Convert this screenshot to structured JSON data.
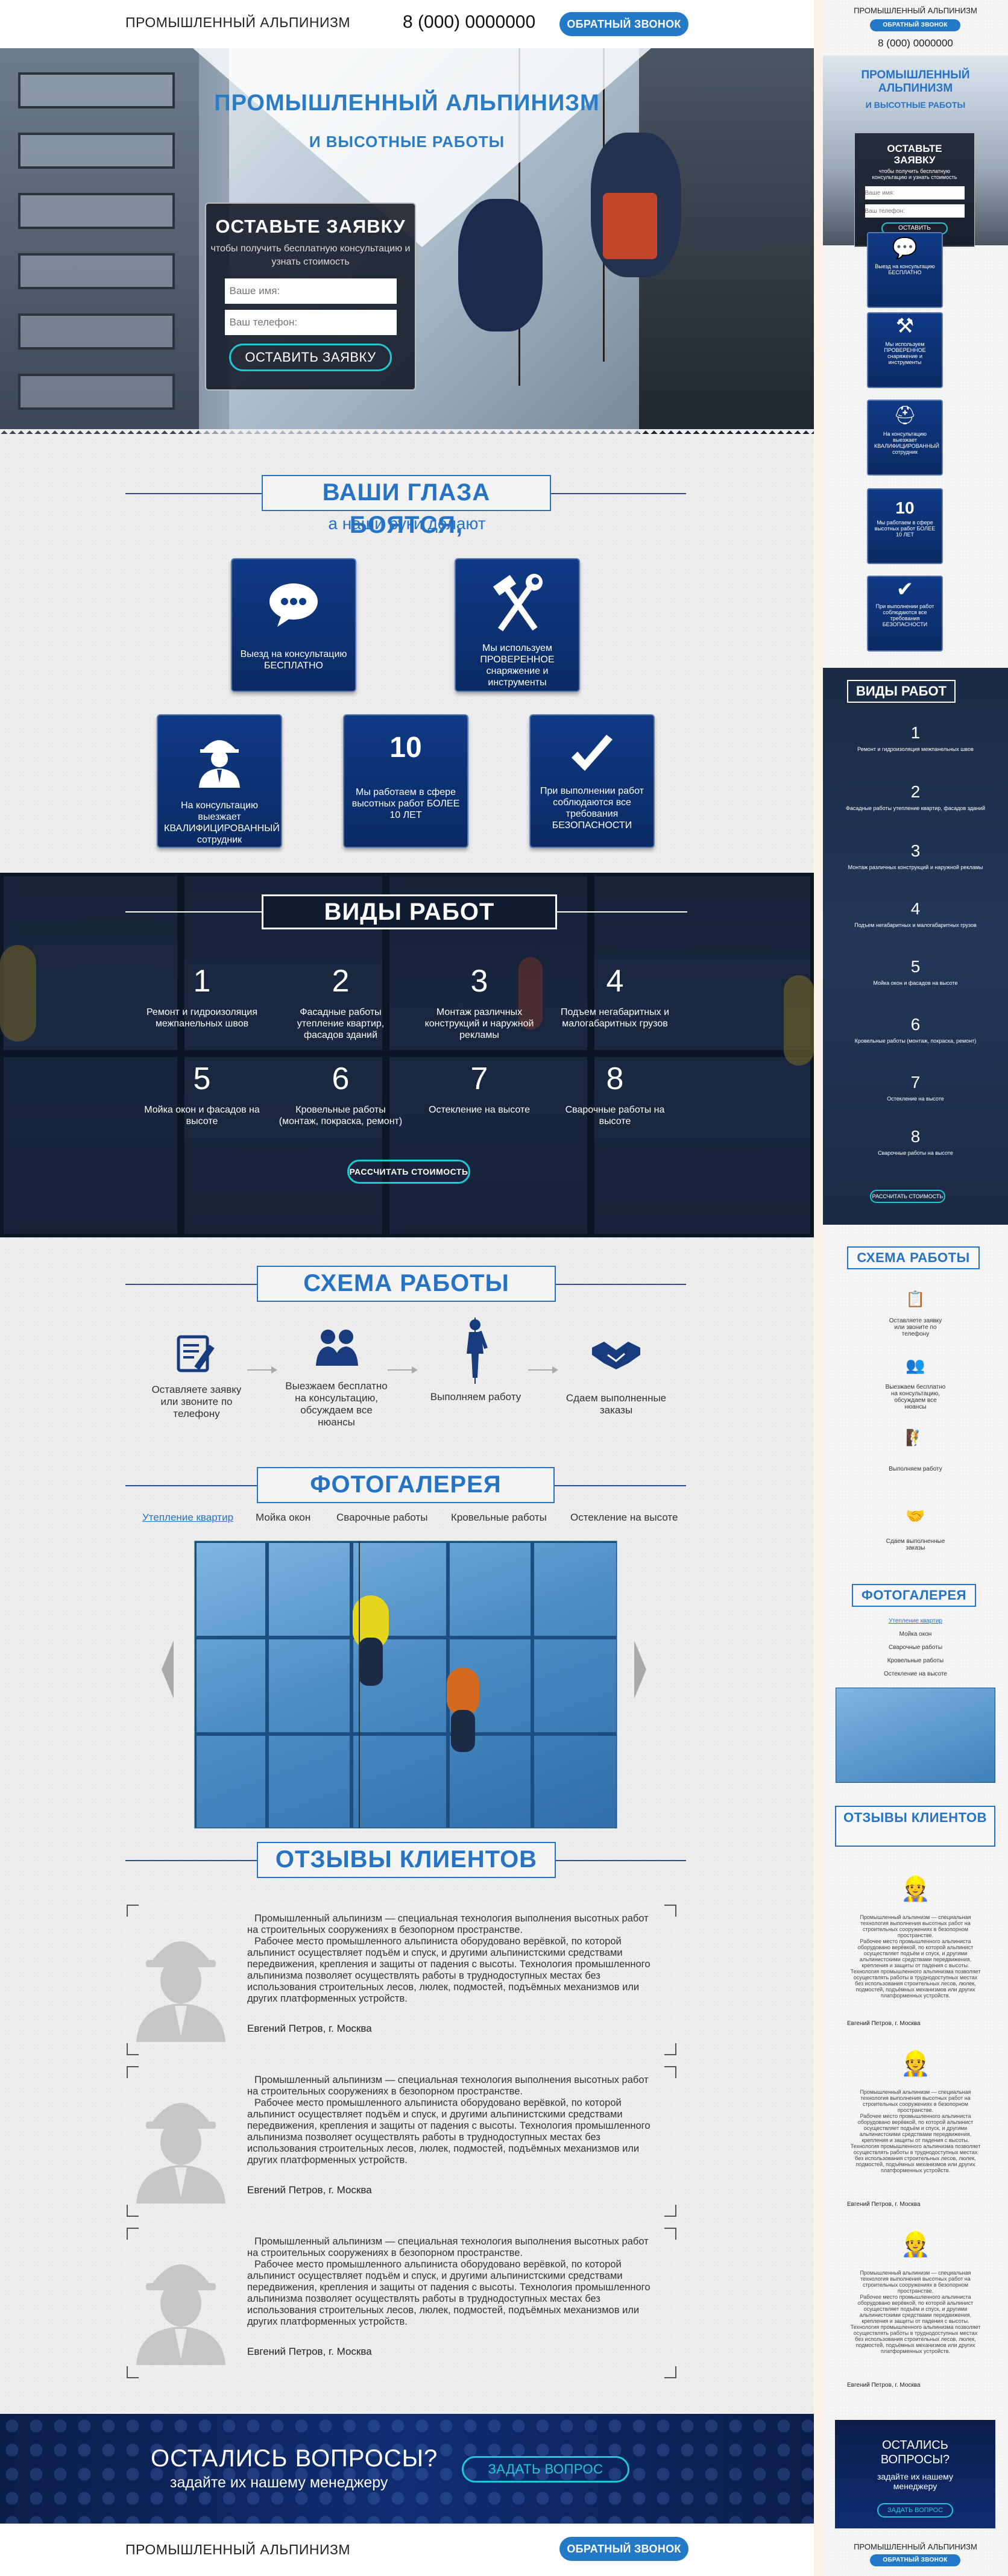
{
  "header": {
    "brand": "ПРОМЫШЛЕННЫЙ АЛЬПИНИЗМ",
    "phone": "8 (000) 0000000",
    "callback": "ОБРАТНЫЙ ЗВОНОК"
  },
  "hero": {
    "title": "ПРОМЫШЛЕННЫЙ АЛЬПИНИЗМ",
    "subtitle": "И ВЫСОТНЫЕ РАБОТЫ",
    "form_title": "ОСТАВЬТЕ ЗАЯВКУ",
    "form_text": "чтобы получить бесплатную консультацию и узнать стоимость",
    "name_placeholder": "Ваше имя:",
    "phone_placeholder": "Ваш телефон:",
    "submit": "ОСТАВИТЬ ЗАЯВКУ"
  },
  "features": {
    "title": "ВАШИ ГЛАЗА БОЯТСЯ,",
    "subtitle": "а наши руки делают",
    "items": [
      {
        "text": "Выезд на консультацию БЕСПЛАТНО",
        "icon": "chat-bubble-icon"
      },
      {
        "text": "Мы используем ПРОВЕРЕННОЕ снаряжение и инструменты",
        "icon": "hammer-wrench-icon"
      },
      {
        "text": "На консультацию выезжает КВАЛИФИЦИРОВАННЫЙ сотрудник",
        "icon": "worker-helmet-icon"
      },
      {
        "text": "Мы работаем в сфере высотных работ БОЛЕЕ 10 ЛЕТ",
        "big": "10"
      },
      {
        "text": "При выполнении работ соблюдаются все требования БЕЗОПАСНОСТИ",
        "icon": "checkmark-icon"
      }
    ]
  },
  "works": {
    "title": "ВИДЫ РАБОТ",
    "items": [
      {
        "num": "1",
        "text": "Ремонт и гидроизоляция межпанельных швов"
      },
      {
        "num": "2",
        "text": "Фасадные работы утепление квартир, фасадов зданий"
      },
      {
        "num": "3",
        "text": "Монтаж различных конструкций и наружной рекламы"
      },
      {
        "num": "4",
        "text": "Подъем негабаритных и малогабаритных грузов"
      },
      {
        "num": "5",
        "text": "Мойка окон и фасадов на высоте"
      },
      {
        "num": "6",
        "text": "Кровельные работы (монтаж, покраска, ремонт)"
      },
      {
        "num": "7",
        "text": "Остекление на высоте"
      },
      {
        "num": "8",
        "text": "Сварочные работы на высоте"
      }
    ],
    "button": "РАССЧИТАТЬ СТОИМОСТЬ"
  },
  "scheme": {
    "title": "СХЕМА РАБОТЫ",
    "steps": [
      {
        "text": "Оставляете заявку или звоните по телефону",
        "icon": "form-pencil-icon"
      },
      {
        "text": "Выезжаем бесплатно на консультацию, обсуждаем все нюансы",
        "icon": "meeting-people-icon"
      },
      {
        "text": "Выполняем работу",
        "icon": "climber-icon"
      },
      {
        "text": "Сдаем выполненные заказы",
        "icon": "handshake-icon"
      }
    ]
  },
  "gallery": {
    "title": "ФОТОГАЛЕРЕЯ",
    "tabs": [
      "Утепление квартир",
      "Мойка окон",
      "Сварочные работы",
      "Кровельные работы",
      "Остекление на высоте"
    ],
    "active_tab": "Утепление квартир"
  },
  "reviews": {
    "title": "ОТЗЫВЫ КЛИЕНТОВ",
    "items": [
      {
        "p1": "Промышленный альпинизм — специальная технология выполнения высотных работ на строительных сооружениях в безопорном пространстве.",
        "p2": "Рабочее место промышленного альпиниста оборудовано верёвкой, по которой альпинист осуществляет подъём и спуск, и другими альпинистскими средствами передвижения, крепления и защиты от падения с высоты. Технология промышленного альпинизма позволяет осуществлять работы в труднодоступных местах без использования строительных лесов, люлек, подмостей, подъёмных механизмов или других платформенных устройств.",
        "author": "Евгений Петров, г. Москва"
      },
      {
        "p1": "Промышленный альпинизм — специальная технология выполнения высотных работ на строительных сооружениях в безопорном пространстве.",
        "p2": "Рабочее место промышленного альпиниста оборудовано верёвкой, по которой альпинист осуществляет подъём и спуск, и другими альпинистскими средствами передвижения, крепления и защиты от падения с высоты. Технология промышленного альпинизма позволяет осуществлять работы в труднодоступных местах без использования строительных лесов, люлек, подмостей, подъёмных механизмов или других платформенных устройств.",
        "author": "Евгений Петров, г. Москва"
      },
      {
        "p1": "Промышленный альпинизм — специальная технология выполнения высотных работ на строительных сооружениях в безопорном пространстве.",
        "p2": "Рабочее место промышленного альпиниста оборудовано верёвкой, по которой альпинист осуществляет подъём и спуск, и другими альпинистскими средствами передвижения, крепления и защиты от падения с высоты. Технология промышленного альпинизма позволяет осуществлять работы в труднодоступных местах без использования строительных лесов, люлек, подмостей, подъёмных механизмов или других платформенных устройств.",
        "author": "Евгений Петров, г. Москва"
      }
    ]
  },
  "cta": {
    "title": "ОСТАЛИСЬ ВОПРОСЫ?",
    "subtitle": "задайте их нашему менеджеру",
    "button": "ЗАДАТЬ ВОПРОС"
  },
  "footer": {
    "brand": "ПРОМЫШЛЕННЫЙ АЛЬПИНИЗМ",
    "callback": "ОБРАТНЫЙ ЗВОНОК"
  },
  "mobile": {
    "hero_title": "ПРОМЫШЛЕННЫЙ АЛЬПИНИЗМ",
    "hero_subtitle": "И ВЫСОТНЫЕ РАБОТЫ",
    "form_title": "ОСТАВЬТЕ ЗАЯВКУ",
    "submit": "ОСТАВИТЬ",
    "works_title": "ВИДЫ РАБОТ",
    "scheme_title": "СХЕМА РАБОТЫ",
    "gallery_title": "ФОТОГАЛЕРЕЯ",
    "reviews_title": "ОТЗЫВЫ КЛИЕНТОВ",
    "cta_title": "ОСТАЛИСЬ ВОПРОСЫ?",
    "cta_sub": "задайте их нашему менеджеру",
    "cta_button": "ЗАДАТЬ ВОПРОС"
  },
  "colors": {
    "accent": "#2673c5",
    "navy": "#0f3a85",
    "teal": "#1dc8d4"
  }
}
